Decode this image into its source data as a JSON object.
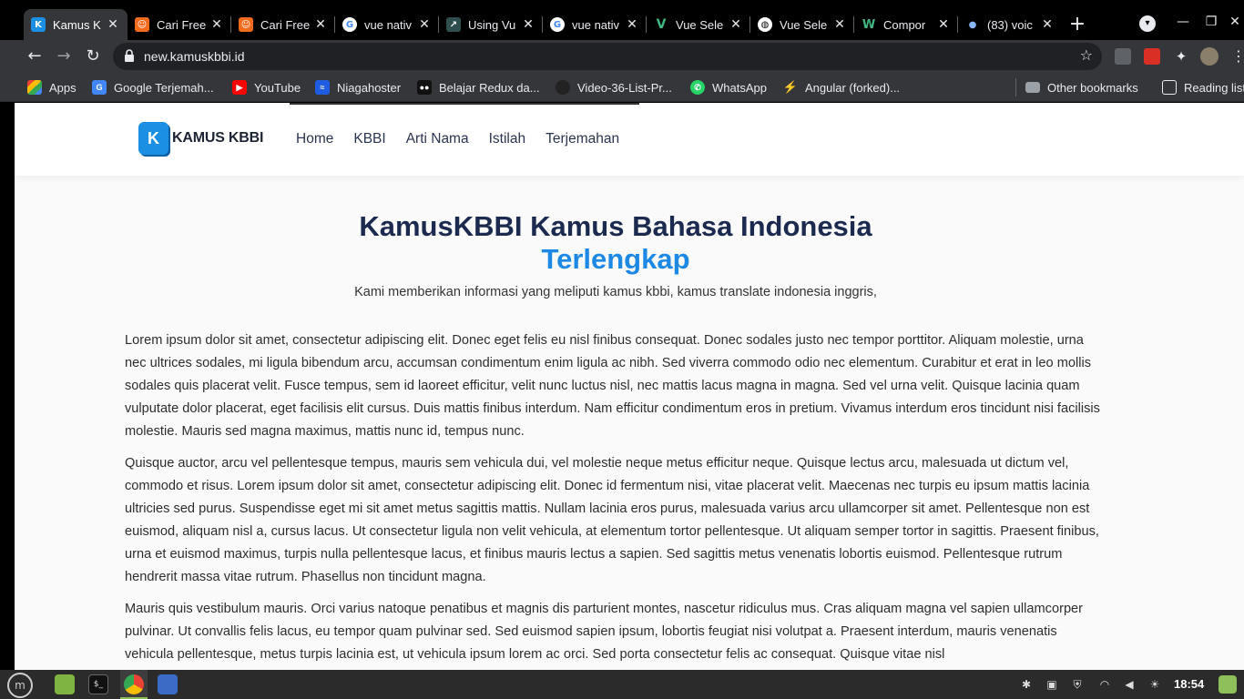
{
  "browser": {
    "tabs": [
      {
        "title": "Kamus K",
        "active": true,
        "icon": "k-icon",
        "color": "#1a8fe3"
      },
      {
        "title": "Cari Free",
        "icon": "freelance-icon",
        "color": "#f26b1d"
      },
      {
        "title": "Cari Free",
        "icon": "freelance-icon",
        "color": "#f26b1d"
      },
      {
        "title": "vue nativ",
        "icon": "google-icon",
        "color": "#ffffff"
      },
      {
        "title": "Using Vu",
        "icon": "site-icon",
        "color": "#5f9ea0"
      },
      {
        "title": "vue nativ",
        "icon": "google-icon",
        "color": "#ffffff"
      },
      {
        "title": "Vue Sele",
        "icon": "vue-icon",
        "color": "#41b883"
      },
      {
        "title": "Vue Sele",
        "icon": "globe-icon",
        "color": "#ffffff"
      },
      {
        "title": "Compor",
        "icon": "vue-icon",
        "color": "#41b883"
      },
      {
        "title": "(83) voic",
        "icon": "dot-icon",
        "color": "#8ab4f8"
      }
    ],
    "url": "new.kamuskbbi.id",
    "bookmarks": [
      {
        "label": "Apps",
        "icon": "apps-grid-icon",
        "color": "#e94235"
      },
      {
        "label": "Google Terjemah...",
        "icon": "translate-icon",
        "color": "#4285f4"
      },
      {
        "label": "YouTube",
        "icon": "youtube-icon",
        "color": "#ff0000"
      },
      {
        "label": "Niagahoster",
        "icon": "niagahoster-icon",
        "color": "#1f5ce0"
      },
      {
        "label": "Belajar Redux da...",
        "icon": "medium-icon",
        "color": "#111111"
      },
      {
        "label": "Video-36-List-Pr...",
        "icon": "github-icon",
        "color": "#222222"
      },
      {
        "label": "WhatsApp",
        "icon": "whatsapp-icon",
        "color": "#25d366"
      },
      {
        "label": "Angular (forked)...",
        "icon": "stackblitz-icon",
        "color": "#1389fd"
      }
    ],
    "other_bookmarks": "Other bookmarks",
    "reading_list": "Reading list"
  },
  "site": {
    "logo_letter": "K",
    "logo_text": "KAMUS KBBI",
    "nav": [
      "Home",
      "KBBI",
      "Arti Nama",
      "Istilah",
      "Terjemahan"
    ],
    "hero_title": "KamusKBBI Kamus Bahasa Indonesia",
    "hero_accent": "Terlengkap",
    "hero_subtitle": "Kami memberikan informasi yang meliputi kamus kbbi, kamus translate indonesia inggris,",
    "paragraphs": [
      "Lorem ipsum dolor sit amet, consectetur adipiscing elit. Donec eget felis eu nisl finibus consequat. Donec sodales justo nec tempor porttitor. Aliquam molestie, urna nec ultrices sodales, mi ligula bibendum arcu, accumsan condimentum enim ligula ac nibh. Sed viverra commodo odio nec elementum. Curabitur et erat in leo mollis sodales quis placerat velit. Fusce tempus, sem id laoreet efficitur, velit nunc luctus nisl, nec mattis lacus magna in magna. Sed vel urna velit. Quisque lacinia quam vulputate dolor placerat, eget facilisis elit cursus. Duis mattis finibus interdum. Nam efficitur condimentum eros in pretium. Vivamus interdum eros tincidunt nisi facilisis molestie. Mauris sed magna maximus, mattis nunc id, tempus nunc.",
      "Quisque auctor, arcu vel pellentesque tempus, mauris sem vehicula dui, vel molestie neque metus efficitur neque. Quisque lectus arcu, malesuada ut dictum vel, commodo et risus. Lorem ipsum dolor sit amet, consectetur adipiscing elit. Donec id fermentum nisi, vitae placerat velit. Maecenas nec turpis eu ipsum mattis lacinia ultricies sed purus. Suspendisse eget mi sit amet metus sagittis mattis. Nullam lacinia eros purus, malesuada varius arcu ullamcorper sit amet. Pellentesque non est euismod, aliquam nisl a, cursus lacus. Ut consectetur ligula non velit vehicula, at elementum tortor pellentesque. Ut aliquam semper tortor in sagittis. Praesent finibus, urna et euismod maximus, turpis nulla pellentesque lacus, et finibus mauris lectus a sapien. Sed sagittis metus venenatis lobortis euismod. Pellentesque rutrum hendrerit massa vitae rutrum. Phasellus non tincidunt magna.",
      "Mauris quis vestibulum mauris. Orci varius natoque penatibus et magnis dis parturient montes, nascetur ridiculus mus. Cras aliquam magna vel sapien ullamcorper pulvinar. Ut convallis felis lacus, eu tempor quam pulvinar sed. Sed euismod sapien ipsum, lobortis feugiat nisi volutpat a. Praesent interdum, mauris venenatis vehicula pellentesque, metus turpis lacinia est, ut vehicula ipsum lorem ac orci. Sed porta consectetur felis ac consequat. Quisque vitae nisl"
    ]
  },
  "taskbar": {
    "clock": "18:54"
  },
  "colors": {
    "accent": "#1e88e5",
    "heading": "#1b2a4e",
    "browser_dark": "#35363a"
  }
}
